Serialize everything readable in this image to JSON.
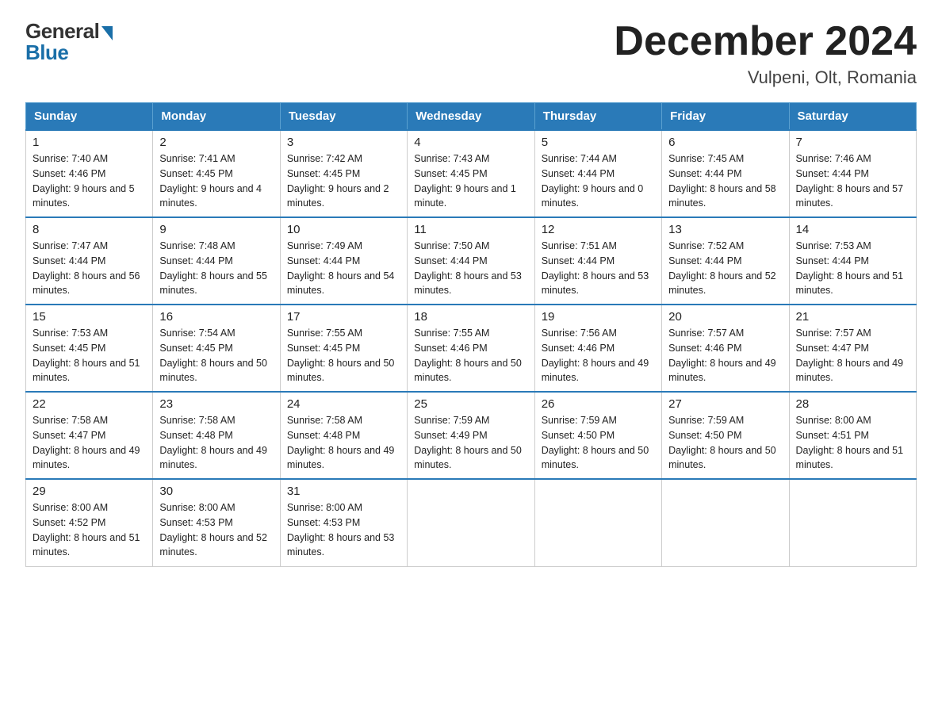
{
  "logo": {
    "general": "General",
    "blue": "Blue"
  },
  "title": "December 2024",
  "location": "Vulpeni, Olt, Romania",
  "days_of_week": [
    "Sunday",
    "Monday",
    "Tuesday",
    "Wednesday",
    "Thursday",
    "Friday",
    "Saturday"
  ],
  "weeks": [
    [
      {
        "day": "1",
        "sunrise": "7:40 AM",
        "sunset": "4:46 PM",
        "daylight": "9 hours and 5 minutes."
      },
      {
        "day": "2",
        "sunrise": "7:41 AM",
        "sunset": "4:45 PM",
        "daylight": "9 hours and 4 minutes."
      },
      {
        "day": "3",
        "sunrise": "7:42 AM",
        "sunset": "4:45 PM",
        "daylight": "9 hours and 2 minutes."
      },
      {
        "day": "4",
        "sunrise": "7:43 AM",
        "sunset": "4:45 PM",
        "daylight": "9 hours and 1 minute."
      },
      {
        "day": "5",
        "sunrise": "7:44 AM",
        "sunset": "4:44 PM",
        "daylight": "9 hours and 0 minutes."
      },
      {
        "day": "6",
        "sunrise": "7:45 AM",
        "sunset": "4:44 PM",
        "daylight": "8 hours and 58 minutes."
      },
      {
        "day": "7",
        "sunrise": "7:46 AM",
        "sunset": "4:44 PM",
        "daylight": "8 hours and 57 minutes."
      }
    ],
    [
      {
        "day": "8",
        "sunrise": "7:47 AM",
        "sunset": "4:44 PM",
        "daylight": "8 hours and 56 minutes."
      },
      {
        "day": "9",
        "sunrise": "7:48 AM",
        "sunset": "4:44 PM",
        "daylight": "8 hours and 55 minutes."
      },
      {
        "day": "10",
        "sunrise": "7:49 AM",
        "sunset": "4:44 PM",
        "daylight": "8 hours and 54 minutes."
      },
      {
        "day": "11",
        "sunrise": "7:50 AM",
        "sunset": "4:44 PM",
        "daylight": "8 hours and 53 minutes."
      },
      {
        "day": "12",
        "sunrise": "7:51 AM",
        "sunset": "4:44 PM",
        "daylight": "8 hours and 53 minutes."
      },
      {
        "day": "13",
        "sunrise": "7:52 AM",
        "sunset": "4:44 PM",
        "daylight": "8 hours and 52 minutes."
      },
      {
        "day": "14",
        "sunrise": "7:53 AM",
        "sunset": "4:44 PM",
        "daylight": "8 hours and 51 minutes."
      }
    ],
    [
      {
        "day": "15",
        "sunrise": "7:53 AM",
        "sunset": "4:45 PM",
        "daylight": "8 hours and 51 minutes."
      },
      {
        "day": "16",
        "sunrise": "7:54 AM",
        "sunset": "4:45 PM",
        "daylight": "8 hours and 50 minutes."
      },
      {
        "day": "17",
        "sunrise": "7:55 AM",
        "sunset": "4:45 PM",
        "daylight": "8 hours and 50 minutes."
      },
      {
        "day": "18",
        "sunrise": "7:55 AM",
        "sunset": "4:46 PM",
        "daylight": "8 hours and 50 minutes."
      },
      {
        "day": "19",
        "sunrise": "7:56 AM",
        "sunset": "4:46 PM",
        "daylight": "8 hours and 49 minutes."
      },
      {
        "day": "20",
        "sunrise": "7:57 AM",
        "sunset": "4:46 PM",
        "daylight": "8 hours and 49 minutes."
      },
      {
        "day": "21",
        "sunrise": "7:57 AM",
        "sunset": "4:47 PM",
        "daylight": "8 hours and 49 minutes."
      }
    ],
    [
      {
        "day": "22",
        "sunrise": "7:58 AM",
        "sunset": "4:47 PM",
        "daylight": "8 hours and 49 minutes."
      },
      {
        "day": "23",
        "sunrise": "7:58 AM",
        "sunset": "4:48 PM",
        "daylight": "8 hours and 49 minutes."
      },
      {
        "day": "24",
        "sunrise": "7:58 AM",
        "sunset": "4:48 PM",
        "daylight": "8 hours and 49 minutes."
      },
      {
        "day": "25",
        "sunrise": "7:59 AM",
        "sunset": "4:49 PM",
        "daylight": "8 hours and 50 minutes."
      },
      {
        "day": "26",
        "sunrise": "7:59 AM",
        "sunset": "4:50 PM",
        "daylight": "8 hours and 50 minutes."
      },
      {
        "day": "27",
        "sunrise": "7:59 AM",
        "sunset": "4:50 PM",
        "daylight": "8 hours and 50 minutes."
      },
      {
        "day": "28",
        "sunrise": "8:00 AM",
        "sunset": "4:51 PM",
        "daylight": "8 hours and 51 minutes."
      }
    ],
    [
      {
        "day": "29",
        "sunrise": "8:00 AM",
        "sunset": "4:52 PM",
        "daylight": "8 hours and 51 minutes."
      },
      {
        "day": "30",
        "sunrise": "8:00 AM",
        "sunset": "4:53 PM",
        "daylight": "8 hours and 52 minutes."
      },
      {
        "day": "31",
        "sunrise": "8:00 AM",
        "sunset": "4:53 PM",
        "daylight": "8 hours and 53 minutes."
      },
      null,
      null,
      null,
      null
    ]
  ],
  "labels": {
    "sunrise": "Sunrise:",
    "sunset": "Sunset:",
    "daylight": "Daylight:"
  }
}
